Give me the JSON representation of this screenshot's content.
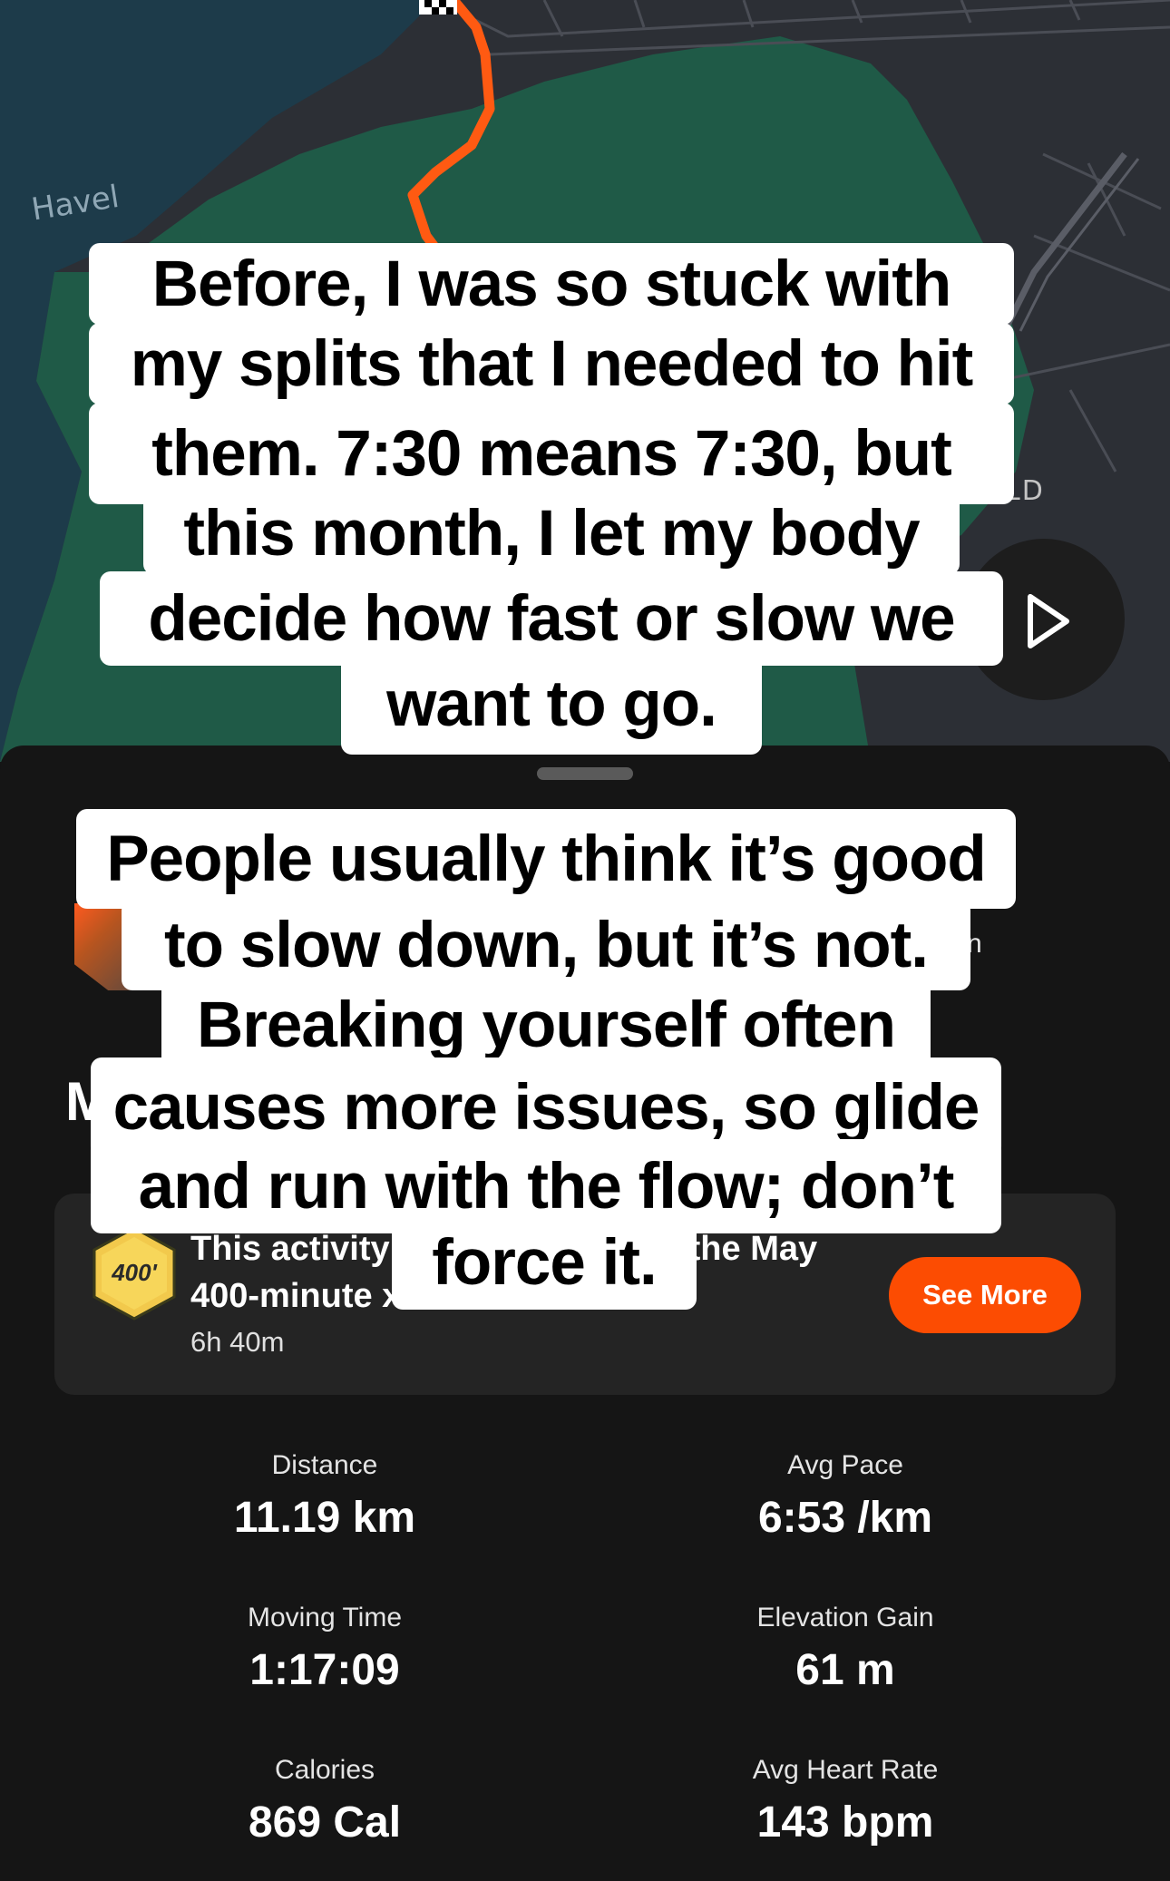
{
  "map": {
    "label_havel": "Havel",
    "label_partial": "LD"
  },
  "captions": {
    "first": [
      "Before, I was so stuck with",
      "my splits that I needed to hit",
      "them. 7:30 means 7:30, but",
      "this month, I let my body",
      "decide how fast or slow we",
      "want to go."
    ],
    "second": [
      "People usually think it’s good",
      "to slow down, but it’s not.",
      "Breaking yourself often",
      "causes more issues, so glide",
      "and run with the flow; don’t",
      "force it."
    ]
  },
  "activity": {
    "header_fragment": "n",
    "title_fragment": "M"
  },
  "challenge": {
    "line1_left": "This activity",
    "line1_right": "the May",
    "line2": "400-minute x",
    "time": "6h 40m",
    "badge_text": "400'",
    "see_more": "See More"
  },
  "stats": [
    {
      "label": "Distance",
      "value": "11.19 km"
    },
    {
      "label": "Avg Pace",
      "value": "6:53 /km"
    },
    {
      "label": "Moving Time",
      "value": "1:17:09"
    },
    {
      "label": "Elevation Gain",
      "value": "61 m"
    },
    {
      "label": "Calories",
      "value": "869 Cal"
    },
    {
      "label": "Avg Heart Rate",
      "value": "143 bpm"
    }
  ],
  "colors": {
    "accent": "#fc4c02",
    "route": "#ff5a12",
    "water": "#1d3b4a",
    "park": "#1f5a47",
    "land": "#2c2f35"
  }
}
